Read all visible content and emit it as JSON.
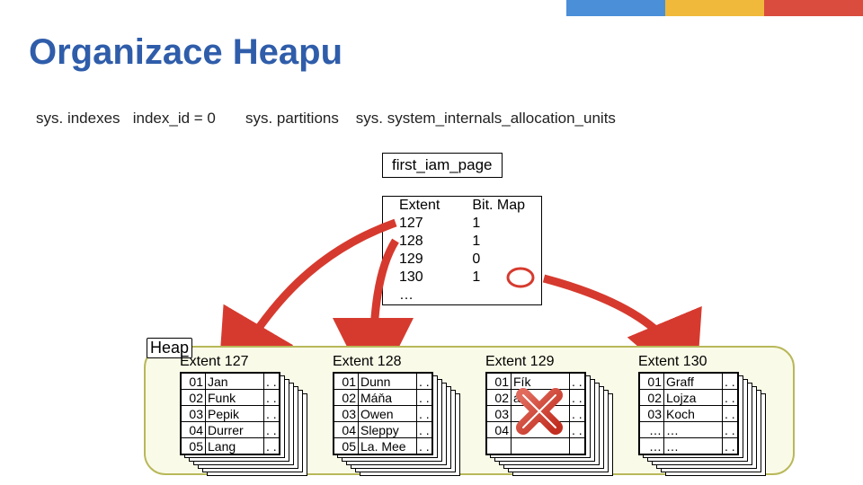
{
  "title": "Organizace Heapu",
  "labels": {
    "sys_indexes": "sys. indexes",
    "index_id": "index_id = 0",
    "sys_partitions": "sys. partitions",
    "sys_alloc": "sys. system_internals_allocation_units"
  },
  "first_iam_page": "first_iam_page",
  "iam": {
    "col1": "Extent",
    "col2": "Bit. Map",
    "rows": [
      {
        "extent": "127",
        "bit": "1"
      },
      {
        "extent": "128",
        "bit": "1"
      },
      {
        "extent": "129",
        "bit": "0"
      },
      {
        "extent": "130",
        "bit": "1"
      },
      {
        "extent": "…",
        "bit": ""
      }
    ]
  },
  "heap_label": "Heap",
  "extents": [
    {
      "title": "Extent 127",
      "rows": [
        [
          "01",
          "Jan",
          ". ."
        ],
        [
          "02",
          "Funk",
          ". ."
        ],
        [
          "03",
          "Pepik",
          ". ."
        ],
        [
          "04",
          "Durrer",
          ". ."
        ],
        [
          "05",
          "Lang",
          ". ."
        ]
      ]
    },
    {
      "title": "Extent 128",
      "rows": [
        [
          "01",
          "Dunn",
          ". ."
        ],
        [
          "02",
          "Máňa",
          ". ."
        ],
        [
          "03",
          "Owen",
          ". ."
        ],
        [
          "04",
          "Sleppy",
          ". ."
        ],
        [
          "05",
          "La. Mee",
          ". ."
        ]
      ]
    },
    {
      "title": "Extent 129",
      "rows": [
        [
          "01",
          "Fík",
          ". ."
        ],
        [
          "02",
          "aris",
          ". ."
        ],
        [
          "03",
          "",
          ". ."
        ],
        [
          "04",
          "",
          ". ."
        ],
        [
          "",
          "",
          ""
        ]
      ]
    },
    {
      "title": "Extent 130",
      "rows": [
        [
          "01",
          "Graff",
          ". ."
        ],
        [
          "02",
          "Lojza",
          ". ."
        ],
        [
          "03",
          "Koch",
          ". ."
        ],
        [
          "…",
          "…",
          ". ."
        ],
        [
          "…",
          "…",
          ". ."
        ]
      ]
    }
  ]
}
